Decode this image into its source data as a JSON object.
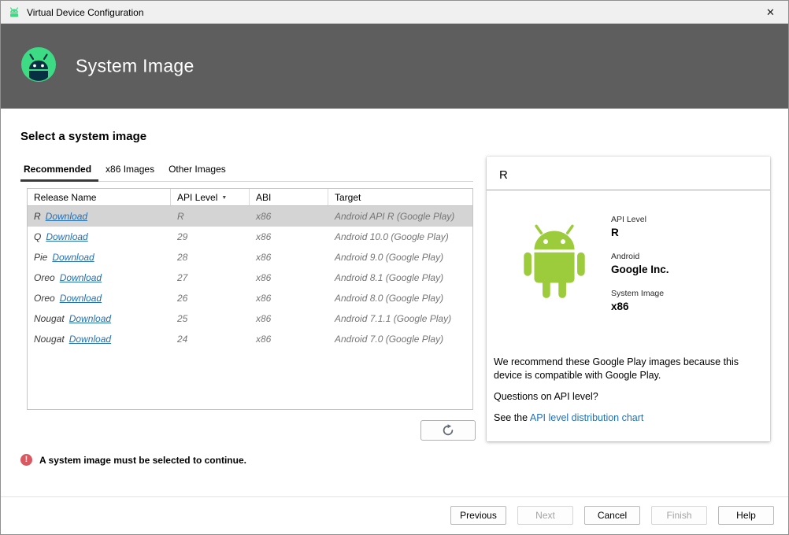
{
  "window": {
    "title": "Virtual Device Configuration"
  },
  "header": {
    "title": "System Image"
  },
  "icons": {
    "close": "✕",
    "sort_arrow": "▼",
    "error_mark": "!"
  },
  "colors": {
    "header_bg": "#5e5e5e",
    "android_green": "#3ddc84",
    "robot_green": "#9ccb3b",
    "link_blue": "#2470b3",
    "error_red": "#db5860",
    "selected_row_bg": "#d4d4d4"
  },
  "main": {
    "heading": "Select a system image",
    "tabs": [
      {
        "label": "Recommended",
        "selected": true
      },
      {
        "label": "x86 Images",
        "selected": false
      },
      {
        "label": "Other Images",
        "selected": false
      }
    ],
    "table": {
      "columns": [
        {
          "label": "Release Name"
        },
        {
          "label": "API Level",
          "sorted": true
        },
        {
          "label": "ABI"
        },
        {
          "label": "Target"
        }
      ],
      "rows": [
        {
          "release": "R",
          "download": "Download",
          "api": "R",
          "abi": "x86",
          "target": "Android API R (Google Play)",
          "selected": true
        },
        {
          "release": "Q",
          "download": "Download",
          "api": "29",
          "abi": "x86",
          "target": "Android 10.0 (Google Play)",
          "selected": false
        },
        {
          "release": "Pie",
          "download": "Download",
          "api": "28",
          "abi": "x86",
          "target": "Android 9.0 (Google Play)",
          "selected": false
        },
        {
          "release": "Oreo",
          "download": "Download",
          "api": "27",
          "abi": "x86",
          "target": "Android 8.1 (Google Play)",
          "selected": false
        },
        {
          "release": "Oreo",
          "download": "Download",
          "api": "26",
          "abi": "x86",
          "target": "Android 8.0 (Google Play)",
          "selected": false
        },
        {
          "release": "Nougat",
          "download": "Download",
          "api": "25",
          "abi": "x86",
          "target": "Android 7.1.1 (Google Play)",
          "selected": false
        },
        {
          "release": "Nougat",
          "download": "Download",
          "api": "24",
          "abi": "x86",
          "target": "Android 7.0 (Google Play)",
          "selected": false
        }
      ]
    }
  },
  "detail": {
    "title": "R",
    "fields": [
      {
        "label": "API Level",
        "value": "R"
      },
      {
        "label": "Android",
        "value": "Google Inc."
      },
      {
        "label": "System Image",
        "value": "x86"
      }
    ],
    "recommendation": "We recommend these Google Play images because this device is compatible with Google Play.",
    "question": "Questions on API level?",
    "see_the": "See the ",
    "link": "API level distribution chart"
  },
  "error": {
    "message": "A system image must be selected to continue."
  },
  "footer": {
    "buttons": [
      {
        "label": "Previous",
        "enabled": true
      },
      {
        "label": "Next",
        "enabled": false
      },
      {
        "label": "Cancel",
        "enabled": true
      },
      {
        "label": "Finish",
        "enabled": false
      },
      {
        "label": "Help",
        "enabled": true
      }
    ]
  }
}
